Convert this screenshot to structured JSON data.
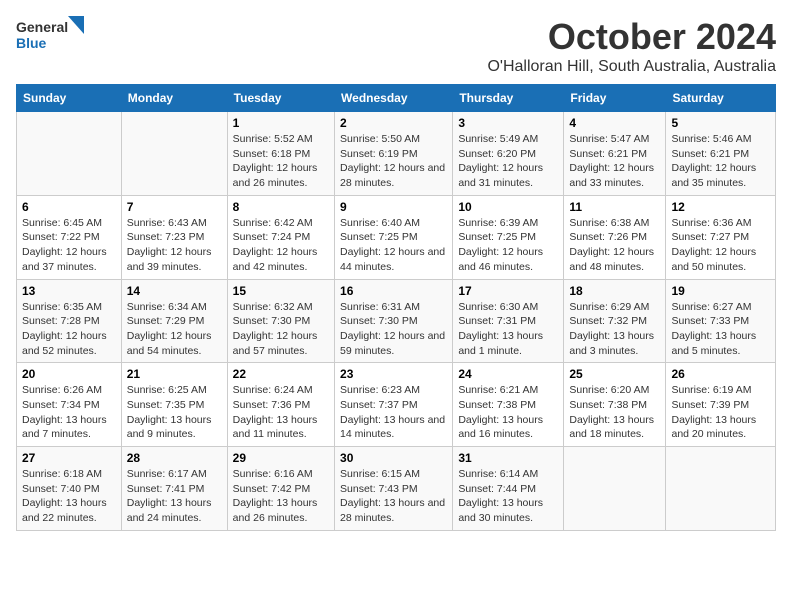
{
  "header": {
    "logo_line1": "General",
    "logo_line2": "Blue",
    "main_title": "October 2024",
    "subtitle": "O'Halloran Hill, South Australia, Australia"
  },
  "columns": [
    "Sunday",
    "Monday",
    "Tuesday",
    "Wednesday",
    "Thursday",
    "Friday",
    "Saturday"
  ],
  "weeks": [
    [
      {
        "day": "",
        "sunrise": "",
        "sunset": "",
        "daylight": ""
      },
      {
        "day": "",
        "sunrise": "",
        "sunset": "",
        "daylight": ""
      },
      {
        "day": "1",
        "sunrise": "Sunrise: 5:52 AM",
        "sunset": "Sunset: 6:18 PM",
        "daylight": "Daylight: 12 hours and 26 minutes."
      },
      {
        "day": "2",
        "sunrise": "Sunrise: 5:50 AM",
        "sunset": "Sunset: 6:19 PM",
        "daylight": "Daylight: 12 hours and 28 minutes."
      },
      {
        "day": "3",
        "sunrise": "Sunrise: 5:49 AM",
        "sunset": "Sunset: 6:20 PM",
        "daylight": "Daylight: 12 hours and 31 minutes."
      },
      {
        "day": "4",
        "sunrise": "Sunrise: 5:47 AM",
        "sunset": "Sunset: 6:21 PM",
        "daylight": "Daylight: 12 hours and 33 minutes."
      },
      {
        "day": "5",
        "sunrise": "Sunrise: 5:46 AM",
        "sunset": "Sunset: 6:21 PM",
        "daylight": "Daylight: 12 hours and 35 minutes."
      }
    ],
    [
      {
        "day": "6",
        "sunrise": "Sunrise: 6:45 AM",
        "sunset": "Sunset: 7:22 PM",
        "daylight": "Daylight: 12 hours and 37 minutes."
      },
      {
        "day": "7",
        "sunrise": "Sunrise: 6:43 AM",
        "sunset": "Sunset: 7:23 PM",
        "daylight": "Daylight: 12 hours and 39 minutes."
      },
      {
        "day": "8",
        "sunrise": "Sunrise: 6:42 AM",
        "sunset": "Sunset: 7:24 PM",
        "daylight": "Daylight: 12 hours and 42 minutes."
      },
      {
        "day": "9",
        "sunrise": "Sunrise: 6:40 AM",
        "sunset": "Sunset: 7:25 PM",
        "daylight": "Daylight: 12 hours and 44 minutes."
      },
      {
        "day": "10",
        "sunrise": "Sunrise: 6:39 AM",
        "sunset": "Sunset: 7:25 PM",
        "daylight": "Daylight: 12 hours and 46 minutes."
      },
      {
        "day": "11",
        "sunrise": "Sunrise: 6:38 AM",
        "sunset": "Sunset: 7:26 PM",
        "daylight": "Daylight: 12 hours and 48 minutes."
      },
      {
        "day": "12",
        "sunrise": "Sunrise: 6:36 AM",
        "sunset": "Sunset: 7:27 PM",
        "daylight": "Daylight: 12 hours and 50 minutes."
      }
    ],
    [
      {
        "day": "13",
        "sunrise": "Sunrise: 6:35 AM",
        "sunset": "Sunset: 7:28 PM",
        "daylight": "Daylight: 12 hours and 52 minutes."
      },
      {
        "day": "14",
        "sunrise": "Sunrise: 6:34 AM",
        "sunset": "Sunset: 7:29 PM",
        "daylight": "Daylight: 12 hours and 54 minutes."
      },
      {
        "day": "15",
        "sunrise": "Sunrise: 6:32 AM",
        "sunset": "Sunset: 7:30 PM",
        "daylight": "Daylight: 12 hours and 57 minutes."
      },
      {
        "day": "16",
        "sunrise": "Sunrise: 6:31 AM",
        "sunset": "Sunset: 7:30 PM",
        "daylight": "Daylight: 12 hours and 59 minutes."
      },
      {
        "day": "17",
        "sunrise": "Sunrise: 6:30 AM",
        "sunset": "Sunset: 7:31 PM",
        "daylight": "Daylight: 13 hours and 1 minute."
      },
      {
        "day": "18",
        "sunrise": "Sunrise: 6:29 AM",
        "sunset": "Sunset: 7:32 PM",
        "daylight": "Daylight: 13 hours and 3 minutes."
      },
      {
        "day": "19",
        "sunrise": "Sunrise: 6:27 AM",
        "sunset": "Sunset: 7:33 PM",
        "daylight": "Daylight: 13 hours and 5 minutes."
      }
    ],
    [
      {
        "day": "20",
        "sunrise": "Sunrise: 6:26 AM",
        "sunset": "Sunset: 7:34 PM",
        "daylight": "Daylight: 13 hours and 7 minutes."
      },
      {
        "day": "21",
        "sunrise": "Sunrise: 6:25 AM",
        "sunset": "Sunset: 7:35 PM",
        "daylight": "Daylight: 13 hours and 9 minutes."
      },
      {
        "day": "22",
        "sunrise": "Sunrise: 6:24 AM",
        "sunset": "Sunset: 7:36 PM",
        "daylight": "Daylight: 13 hours and 11 minutes."
      },
      {
        "day": "23",
        "sunrise": "Sunrise: 6:23 AM",
        "sunset": "Sunset: 7:37 PM",
        "daylight": "Daylight: 13 hours and 14 minutes."
      },
      {
        "day": "24",
        "sunrise": "Sunrise: 6:21 AM",
        "sunset": "Sunset: 7:38 PM",
        "daylight": "Daylight: 13 hours and 16 minutes."
      },
      {
        "day": "25",
        "sunrise": "Sunrise: 6:20 AM",
        "sunset": "Sunset: 7:38 PM",
        "daylight": "Daylight: 13 hours and 18 minutes."
      },
      {
        "day": "26",
        "sunrise": "Sunrise: 6:19 AM",
        "sunset": "Sunset: 7:39 PM",
        "daylight": "Daylight: 13 hours and 20 minutes."
      }
    ],
    [
      {
        "day": "27",
        "sunrise": "Sunrise: 6:18 AM",
        "sunset": "Sunset: 7:40 PM",
        "daylight": "Daylight: 13 hours and 22 minutes."
      },
      {
        "day": "28",
        "sunrise": "Sunrise: 6:17 AM",
        "sunset": "Sunset: 7:41 PM",
        "daylight": "Daylight: 13 hours and 24 minutes."
      },
      {
        "day": "29",
        "sunrise": "Sunrise: 6:16 AM",
        "sunset": "Sunset: 7:42 PM",
        "daylight": "Daylight: 13 hours and 26 minutes."
      },
      {
        "day": "30",
        "sunrise": "Sunrise: 6:15 AM",
        "sunset": "Sunset: 7:43 PM",
        "daylight": "Daylight: 13 hours and 28 minutes."
      },
      {
        "day": "31",
        "sunrise": "Sunrise: 6:14 AM",
        "sunset": "Sunset: 7:44 PM",
        "daylight": "Daylight: 13 hours and 30 minutes."
      },
      {
        "day": "",
        "sunrise": "",
        "sunset": "",
        "daylight": ""
      },
      {
        "day": "",
        "sunrise": "",
        "sunset": "",
        "daylight": ""
      }
    ]
  ]
}
